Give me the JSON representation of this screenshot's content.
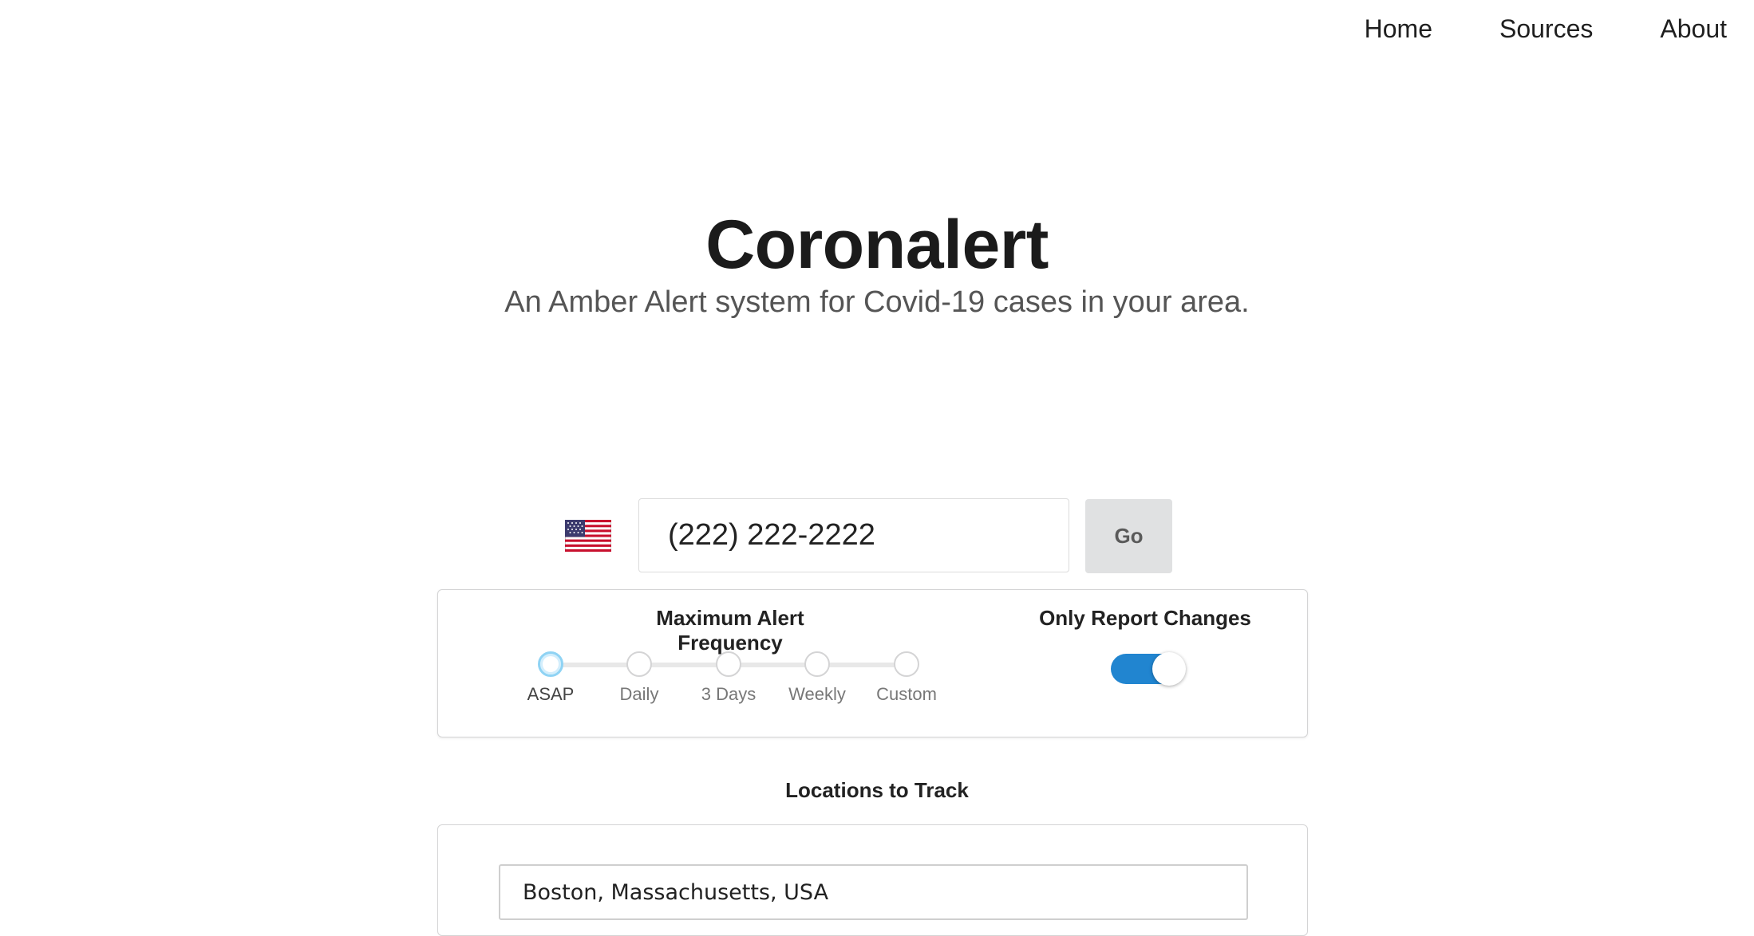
{
  "nav": {
    "items": [
      "Home",
      "Sources",
      "About"
    ]
  },
  "hero": {
    "title": "Coronalert",
    "subtitle": "An Amber Alert system for Covid-19 cases in your area."
  },
  "signup": {
    "country_flag_icon": "us-flag-icon",
    "phone_value": "(222) 222-2222",
    "go_label": "Go"
  },
  "frequency": {
    "label": "Maximum Alert Frequency",
    "options": [
      "ASAP",
      "Daily",
      "3 Days",
      "Weekly",
      "Custom"
    ],
    "selected": "ASAP"
  },
  "changes": {
    "label": "Only Report Changes",
    "enabled": true,
    "accent_color": "#2185d0"
  },
  "locations": {
    "label": "Locations to Track",
    "items": [
      "Boston, Massachusetts, USA"
    ]
  }
}
